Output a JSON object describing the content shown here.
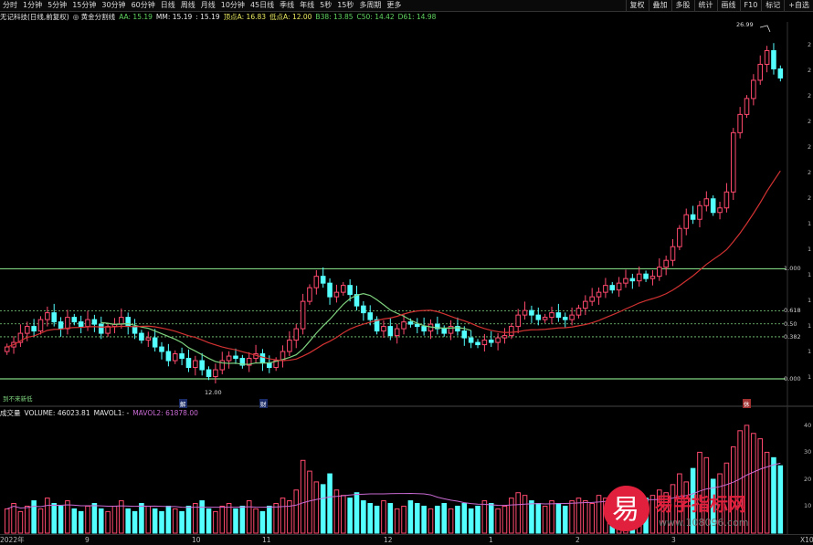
{
  "topbar": {
    "periods": [
      "分时",
      "1分钟",
      "5分钟",
      "15分钟",
      "30分钟",
      "60分钟",
      "日线",
      "周线",
      "月线",
      "10分钟",
      "45日线",
      "季线",
      "年线",
      "5秒",
      "15秒",
      "多周期",
      "更多"
    ],
    "tools": [
      "复权",
      "叠加",
      "多股",
      "统计",
      "画线",
      "F10",
      "标记",
      "+自选"
    ]
  },
  "legend": {
    "stock": "无记科技(日线,前复权)",
    "indicator": "◎ 黄金分割线",
    "items": [
      {
        "text": "AA: 15.19",
        "color": "#5fd35f"
      },
      {
        "text": "MM: 15.19",
        "color": "#e8e8e8"
      },
      {
        "text": ": 15.19",
        "color": "#e8e8e8"
      },
      {
        "text": "顶点A: 16.83",
        "color": "#e8e85f"
      },
      {
        "text": "低点A: 12.00",
        "color": "#e8e85f"
      },
      {
        "text": "B38: 13.85",
        "color": "#5fd35f"
      },
      {
        "text": "C50: 14.42",
        "color": "#5fd35f"
      },
      {
        "text": "D61: 14.98",
        "color": "#5fd35f"
      }
    ]
  },
  "vol_legend": {
    "name": "成交量",
    "volume": "VOLUME: 46023.81",
    "mavol1": "MAVOL1: -",
    "mavol2": "MAVOL2: 61878.00"
  },
  "fib_levels": [
    {
      "label": "1.000",
      "ratio": 1.0
    },
    {
      "label": "0.618",
      "ratio": 0.618
    },
    {
      "label": "0.50",
      "ratio": 0.5
    },
    {
      "label": "0.382",
      "ratio": 0.382
    },
    {
      "label": "0.000",
      "ratio": 0.0
    }
  ],
  "annotations": {
    "high_price": "26.99",
    "low_price": "12.00",
    "corner_label": "到不来新低",
    "badge_1": "解",
    "badge_2": "财",
    "badge_3": "休"
  },
  "x_axis": [
    "2022年",
    "9",
    "10",
    "11",
    "12",
    "1",
    "2",
    "3"
  ],
  "price_axis": [
    "2",
    "2",
    "2",
    "2",
    "2",
    "2",
    "2",
    "1",
    "1",
    "1",
    "1",
    "1",
    "1",
    "1"
  ],
  "vol_axis": [
    "40",
    "30",
    "20",
    "10"
  ],
  "vol_unit": "X10",
  "watermark": {
    "brand": "易学指标网",
    "glyph": "易",
    "url": "www.108096.com"
  },
  "colors": {
    "up": "#ff4a6e",
    "down": "#54ffff",
    "fib": "#7fd37f",
    "ma_short": "#7fd37f",
    "ma_long": "#d23232",
    "mavol2": "#c86ad2"
  },
  "chart_data": {
    "type": "candlestick",
    "price_range": [
      11.0,
      27.5
    ],
    "gold_high": 16.83,
    "gold_low": 12.0,
    "closes": [
      13.4,
      13.6,
      14.0,
      14.3,
      14.1,
      14.6,
      14.9,
      14.5,
      14.2,
      14.7,
      14.5,
      14.3,
      14.6,
      14.4,
      14.0,
      14.3,
      14.4,
      14.7,
      14.3,
      14.0,
      13.7,
      13.8,
      13.4,
      13.2,
      12.8,
      13.1,
      12.9,
      12.5,
      12.8,
      12.4,
      12.1,
      12.4,
      12.8,
      13.0,
      12.9,
      12.6,
      12.9,
      13.1,
      12.7,
      12.5,
      12.8,
      13.2,
      13.7,
      14.2,
      15.4,
      16.0,
      16.5,
      16.2,
      15.6,
      15.8,
      16.1,
      15.7,
      15.2,
      14.9,
      14.6,
      14.1,
      14.3,
      13.9,
      14.2,
      14.5,
      14.4,
      14.3,
      14.1,
      14.4,
      14.2,
      14.0,
      14.3,
      14.1,
      13.8,
      13.6,
      13.5,
      13.7,
      13.6,
      13.8,
      13.9,
      14.3,
      14.8,
      15.0,
      14.8,
      14.6,
      14.7,
      14.9,
      14.7,
      14.6,
      14.8,
      15.1,
      15.4,
      15.6,
      15.8,
      16.1,
      15.9,
      16.2,
      16.4,
      16.3,
      16.6,
      16.4,
      16.5,
      16.9,
      17.2,
      17.8,
      18.6,
      19.2,
      19.0,
      19.6,
      19.9,
      19.3,
      19.5,
      20.2,
      22.8,
      23.6,
      24.3,
      25.1,
      25.8,
      26.4,
      25.6,
      25.2
    ],
    "volumes": [
      9,
      11,
      8,
      10,
      12,
      9,
      13,
      11,
      10,
      12,
      9,
      8,
      10,
      11,
      9,
      8,
      10,
      12,
      9,
      8,
      11,
      10,
      9,
      8,
      10,
      9,
      8,
      10,
      11,
      12,
      9,
      8,
      10,
      11,
      9,
      10,
      12,
      9,
      8,
      10,
      11,
      13,
      12,
      16,
      27,
      23,
      19,
      18,
      22,
      16,
      14,
      13,
      15,
      12,
      11,
      10,
      12,
      11,
      9,
      10,
      12,
      11,
      10,
      9,
      10,
      11,
      9,
      10,
      11,
      9,
      10,
      12,
      11,
      9,
      10,
      13,
      15,
      14,
      12,
      11,
      10,
      12,
      11,
      10,
      12,
      13,
      12,
      11,
      14,
      13,
      12,
      15,
      13,
      14,
      12,
      13,
      14,
      16,
      15,
      18,
      22,
      19,
      24,
      30,
      28,
      20,
      22,
      26,
      32,
      38,
      40,
      37,
      35,
      30,
      28,
      25
    ]
  }
}
